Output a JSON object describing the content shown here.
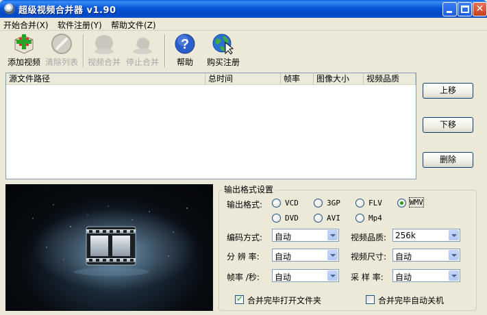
{
  "window": {
    "title": "超级视频合并器 v1.90"
  },
  "menu": [
    {
      "label": "开始合并(X)"
    },
    {
      "label": "软件注册(Y)"
    },
    {
      "label": "帮助文件(Z)"
    }
  ],
  "toolbar": {
    "add_video": "添加视频",
    "clear_list": "清除列表",
    "merge_video": "视频合并",
    "stop_merge": "停止合并",
    "help": "帮助",
    "buy_register": "购买注册"
  },
  "file_list": {
    "columns": [
      "源文件路径",
      "总时间",
      "帧率",
      "图像大小",
      "视频品质"
    ],
    "rows": []
  },
  "side_buttons": {
    "move_up": "上移",
    "move_down": "下移",
    "delete": "删除"
  },
  "output": {
    "group_title": "输出格式设置",
    "format_label": "输出格式:",
    "formats": [
      "VCD",
      "3GP",
      "FLV",
      "WMV",
      "DVD",
      "AVI",
      "Mp4"
    ],
    "selected_format": "WMV",
    "encode_label": "编码方式:",
    "encode_value": "自动",
    "quality_label": "视频品质:",
    "quality_value": "256k",
    "resolution_label": "分 辨 率:",
    "resolution_value": "自动",
    "size_label": "视频尺寸:",
    "size_value": "自动",
    "framerate_label": "帧率 /秒:",
    "framerate_value": "自动",
    "samplerate_label": "采 样 率:",
    "samplerate_value": "自动",
    "open_folder_label": "合并完毕打开文件夹",
    "open_folder_checked": true,
    "shutdown_label": "合并完毕自动关机",
    "shutdown_checked": false
  },
  "colors": {
    "titlebar": "#0a5ee0",
    "window_bg": "#ece9d8",
    "radio_checked": "#21a121"
  }
}
